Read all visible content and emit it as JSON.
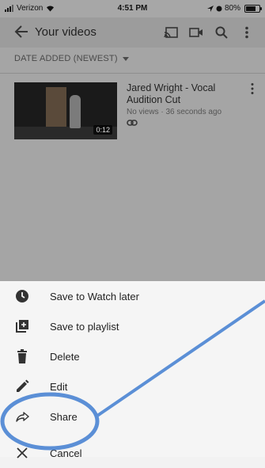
{
  "status_bar": {
    "carrier": "Verizon",
    "time": "4:51 PM",
    "battery": "80%"
  },
  "header": {
    "title": "Your videos"
  },
  "sort": {
    "label": "DATE ADDED (NEWEST)"
  },
  "video": {
    "title": "Jared Wright - Vocal Audition Cut",
    "meta": "No views · 36 seconds ago",
    "duration": "0:12"
  },
  "sheet": {
    "items": [
      {
        "label": "Save to Watch later",
        "icon": "clock-icon"
      },
      {
        "label": "Save to playlist",
        "icon": "playlist-add-icon"
      },
      {
        "label": "Delete",
        "icon": "trash-icon"
      },
      {
        "label": "Edit",
        "icon": "pencil-icon"
      },
      {
        "label": "Share",
        "icon": "share-icon"
      },
      {
        "label": "Cancel",
        "icon": "close-icon"
      }
    ]
  },
  "colors": {
    "annotation": "#5b8fd6",
    "overlay": "#a5a5a5"
  }
}
